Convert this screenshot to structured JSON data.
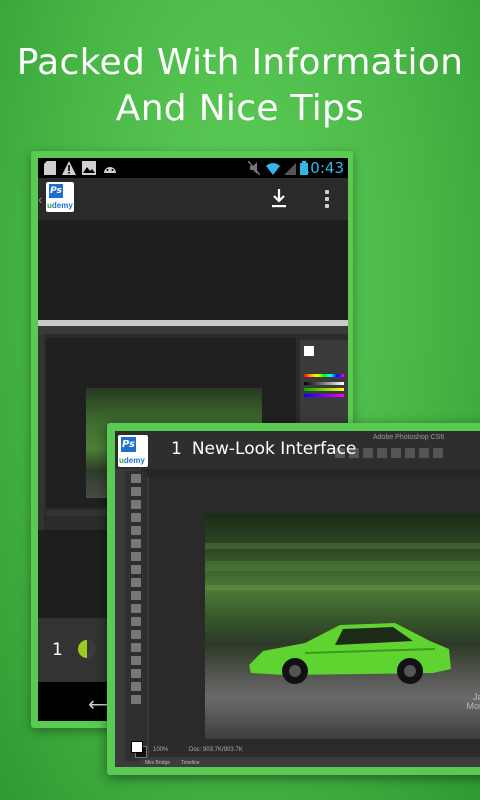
{
  "headline": {
    "line1": "Packed With Information",
    "line2": "And Nice Tips"
  },
  "back_phone": {
    "status_time": "10:43",
    "page_number": "1",
    "progress": 0.5
  },
  "front_tablet": {
    "lesson_number": "1",
    "lesson_title": "New-Look Interface",
    "app_window_title": "Adobe Photoshop CS6",
    "zoom": "100%",
    "doc_info": "Doc: 903.7K/903.7K",
    "tabs": [
      "Mini Bridge",
      "Timeline"
    ],
    "watermark_line1": "Jason",
    "watermark_line2": "Morgan"
  },
  "colors": {
    "accent_green": "#5acb52",
    "status_time_blue": "#33b5e5"
  }
}
